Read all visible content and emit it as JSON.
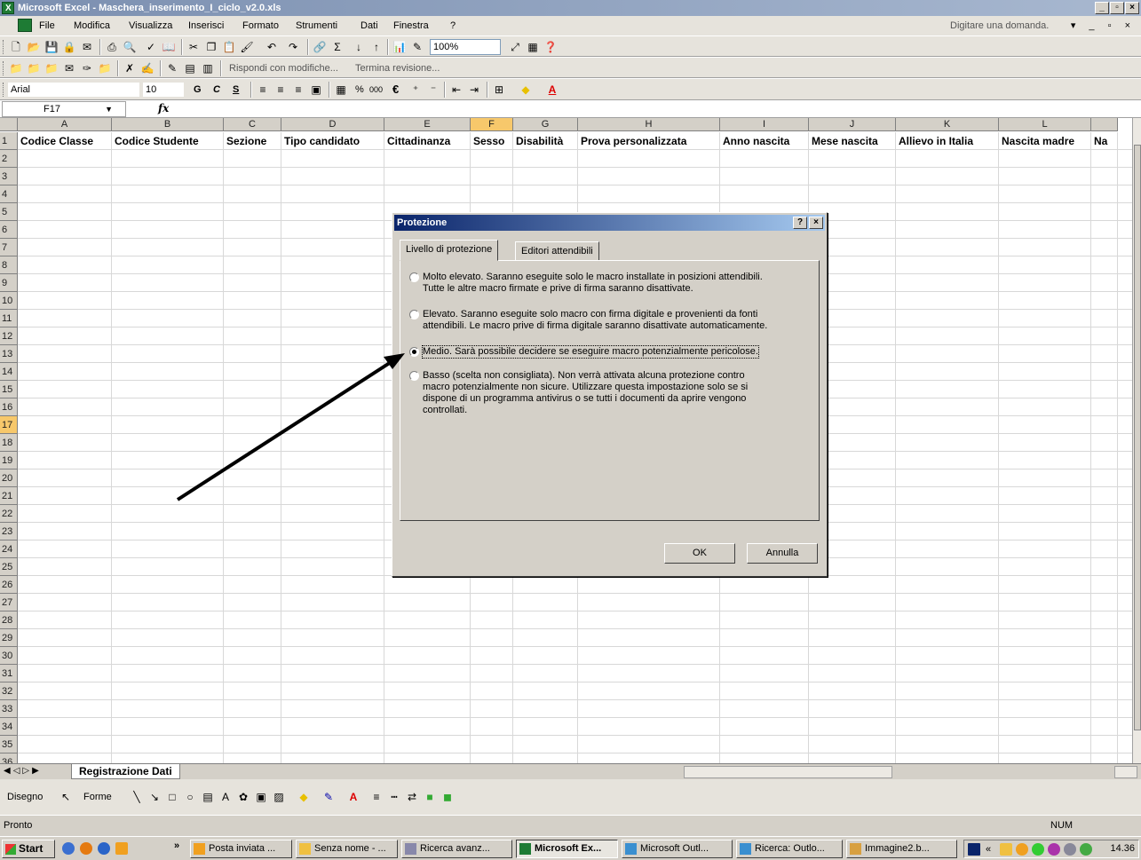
{
  "window": {
    "title": "Microsoft Excel - Maschera_inserimento_I_ciclo_v2.0.xls"
  },
  "menu": {
    "items": [
      {
        "label": "File"
      },
      {
        "label": "Modifica"
      },
      {
        "label": "Visualizza"
      },
      {
        "label": "Inserisci"
      },
      {
        "label": "Formato"
      },
      {
        "label": "Strumenti"
      },
      {
        "label": "Dati"
      },
      {
        "label": "Finestra"
      },
      {
        "label": "?"
      }
    ],
    "ask": "Digitare una domanda."
  },
  "toolbar": {
    "zoom": "100%",
    "review_reply": "Rispondi con modifiche...",
    "review_end": "Termina revisione...",
    "font": "Arial",
    "font_size": "10",
    "bold": "G",
    "italic": "C",
    "underline": "S",
    "percent": "%",
    "thousands": "000",
    "euro": "€"
  },
  "formula": {
    "cell": "F17",
    "fx": "fx"
  },
  "sheet": {
    "columns": [
      "A",
      "B",
      "C",
      "D",
      "E",
      "F",
      "G",
      "H",
      "I",
      "J",
      "K",
      "L"
    ],
    "selected_column": "F",
    "selected_row": 17,
    "rows": [
      "1",
      "2",
      "3",
      "4",
      "5",
      "6",
      "7",
      "8",
      "9",
      "10",
      "11",
      "12",
      "13",
      "14",
      "15",
      "16",
      "17",
      "18",
      "19",
      "20",
      "21",
      "22",
      "23",
      "24",
      "25",
      "26",
      "27",
      "28",
      "29",
      "30",
      "31",
      "32",
      "33",
      "34",
      "35",
      "36"
    ],
    "headers": [
      "Codice Classe",
      "Codice Studente",
      "Sezione",
      "Tipo candidato",
      "Cittadinanza",
      "Sesso",
      "Disabilità",
      "Prova personalizzata",
      "Anno nascita",
      "Mese nascita",
      "Allievo in Italia",
      "Nascita madre",
      "Na"
    ],
    "tab": "Registrazione Dati"
  },
  "drawbar": {
    "disegno": "Disegno",
    "forme": "Forme"
  },
  "status": {
    "text": "Pronto",
    "num": "NUM"
  },
  "taskbar": {
    "start": "Start",
    "buttons": [
      {
        "label": "Posta inviata ..."
      },
      {
        "label": "Senza nome - ..."
      },
      {
        "label": "Ricerca avanz..."
      },
      {
        "label": "Microsoft Ex..."
      },
      {
        "label": "Microsoft Outl..."
      },
      {
        "label": "Ricerca: Outlo..."
      },
      {
        "label": "Immagine2.b..."
      }
    ],
    "clock": "14.36"
  },
  "dialog": {
    "title": "Protezione",
    "tabs": [
      {
        "label": "Livello di protezione"
      },
      {
        "label": "Editori attendibili"
      }
    ],
    "options": [
      {
        "line1": "Molto elevato. Saranno eseguite solo le macro installate in posizioni attendibili.",
        "line2": "Tutte le altre macro firmate e prive di firma saranno disattivate.",
        "checked": false
      },
      {
        "line1": "Elevato. Saranno eseguite solo macro con firma digitale e provenienti da fonti",
        "line2": "attendibili. Le macro prive di firma digitale saranno disattivate automaticamente.",
        "checked": false
      },
      {
        "line1": "Medio. Sarà possibile decidere se eseguire macro potenzialmente pericolose.",
        "checked": true
      },
      {
        "line1": "Basso (scelta non consigliata). Non verrà attivata alcuna protezione contro",
        "line2": "macro potenzialmente non sicure. Utilizzare questa impostazione solo se si",
        "line3": "dispone di un programma antivirus o se tutti i documenti da aprire vengono",
        "line4": "controllati.",
        "checked": false
      }
    ],
    "ok": "OK",
    "cancel": "Annulla",
    "help": "?",
    "close": "×"
  }
}
